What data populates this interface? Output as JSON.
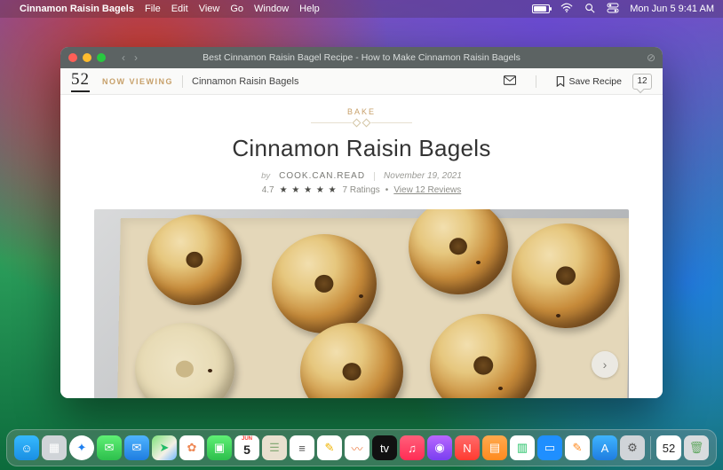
{
  "menubar": {
    "app_name": "Cinnamon Raisin Bagels",
    "items": [
      "File",
      "Edit",
      "View",
      "Go",
      "Window",
      "Help"
    ],
    "clock": "Mon Jun 5 9:41 AM"
  },
  "window": {
    "title": "Best Cinnamon Raisin Bagel Recipe - How to Make Cinnamon Raisin Bagels",
    "toolbar": {
      "logo": "52",
      "now_viewing_label": "NOW VIEWING",
      "breadcrumb": "Cinnamon Raisin Bagels",
      "save_label": "Save Recipe",
      "comment_count": "12"
    },
    "article": {
      "section": "BAKE",
      "title": "Cinnamon Raisin Bagels",
      "by_label": "by",
      "author": "COOK.CAN.READ",
      "date": "November 19, 2021",
      "rating_value": "4.7",
      "stars": "★ ★ ★ ★ ★",
      "ratings_count_label": "7 Ratings",
      "reviews_link": "View 12 Reviews"
    }
  },
  "dock": {
    "items": [
      {
        "name": "finder",
        "bg": "linear-gradient(180deg,#36b9ff,#1a8fe3)",
        "glyph": "☺"
      },
      {
        "name": "launchpad",
        "bg": "#d0d4d8",
        "glyph": "▦"
      },
      {
        "name": "safari",
        "bg": "#ffffff",
        "glyph": "✦",
        "circle": true,
        "fg": "#1e7ff0"
      },
      {
        "name": "messages",
        "bg": "linear-gradient(180deg,#5ff075,#2dbf4c)",
        "glyph": "✉"
      },
      {
        "name": "mail",
        "bg": "linear-gradient(180deg,#4fb4ff,#1f7de0)",
        "glyph": "✉"
      },
      {
        "name": "maps",
        "bg": "linear-gradient(135deg,#7fe27a,#f4f0e6 60%,#6fb8ff)",
        "glyph": "➤",
        "fg": "#2b6"
      },
      {
        "name": "photos",
        "bg": "#ffffff",
        "glyph": "✿",
        "fg": "#e85"
      },
      {
        "name": "facetime",
        "bg": "linear-gradient(180deg,#5ff075,#2dbf4c)",
        "glyph": "▣"
      },
      {
        "name": "calendar",
        "bg": "#ffffff",
        "glyph": "5",
        "fg": "#222",
        "top": "JUN"
      },
      {
        "name": "contacts",
        "bg": "#e9e0cf",
        "glyph": "☰",
        "fg": "#8a7"
      },
      {
        "name": "reminders",
        "bg": "#ffffff",
        "glyph": "≡",
        "fg": "#555"
      },
      {
        "name": "notes",
        "bg": "#ffffff",
        "glyph": "✎",
        "fg": "#f0b400"
      },
      {
        "name": "freeform",
        "bg": "#ffffff",
        "glyph": "〰",
        "fg": "#e85"
      },
      {
        "name": "tv",
        "bg": "#111111",
        "glyph": "tv"
      },
      {
        "name": "music",
        "bg": "linear-gradient(180deg,#ff5f7a,#ff2d55)",
        "glyph": "♫"
      },
      {
        "name": "podcasts",
        "bg": "linear-gradient(180deg,#b867ff,#7a3ff0)",
        "glyph": "◉"
      },
      {
        "name": "news",
        "bg": "linear-gradient(180deg,#ff6a6a,#ff3b30)",
        "glyph": "N"
      },
      {
        "name": "books",
        "bg": "linear-gradient(180deg,#ffa94d,#ff8a1f)",
        "glyph": "▤"
      },
      {
        "name": "numbers",
        "bg": "#ffffff",
        "glyph": "▥",
        "fg": "#21c064"
      },
      {
        "name": "keynote",
        "bg": "#1f8fff",
        "glyph": "▭"
      },
      {
        "name": "pages",
        "bg": "#ffffff",
        "glyph": "✎",
        "fg": "#ff8a1f"
      },
      {
        "name": "appstore",
        "bg": "linear-gradient(180deg,#3fb4ff,#1f7de0)",
        "glyph": "A"
      },
      {
        "name": "settings",
        "bg": "#d0d4d8",
        "glyph": "⚙",
        "fg": "#555"
      }
    ],
    "pinned": [
      {
        "name": "food52",
        "bg": "#ffffff",
        "glyph": "52",
        "fg": "#222"
      },
      {
        "name": "trash",
        "bg": "#d9dcde",
        "glyph": "🗑",
        "fg": "#6a6"
      }
    ]
  }
}
